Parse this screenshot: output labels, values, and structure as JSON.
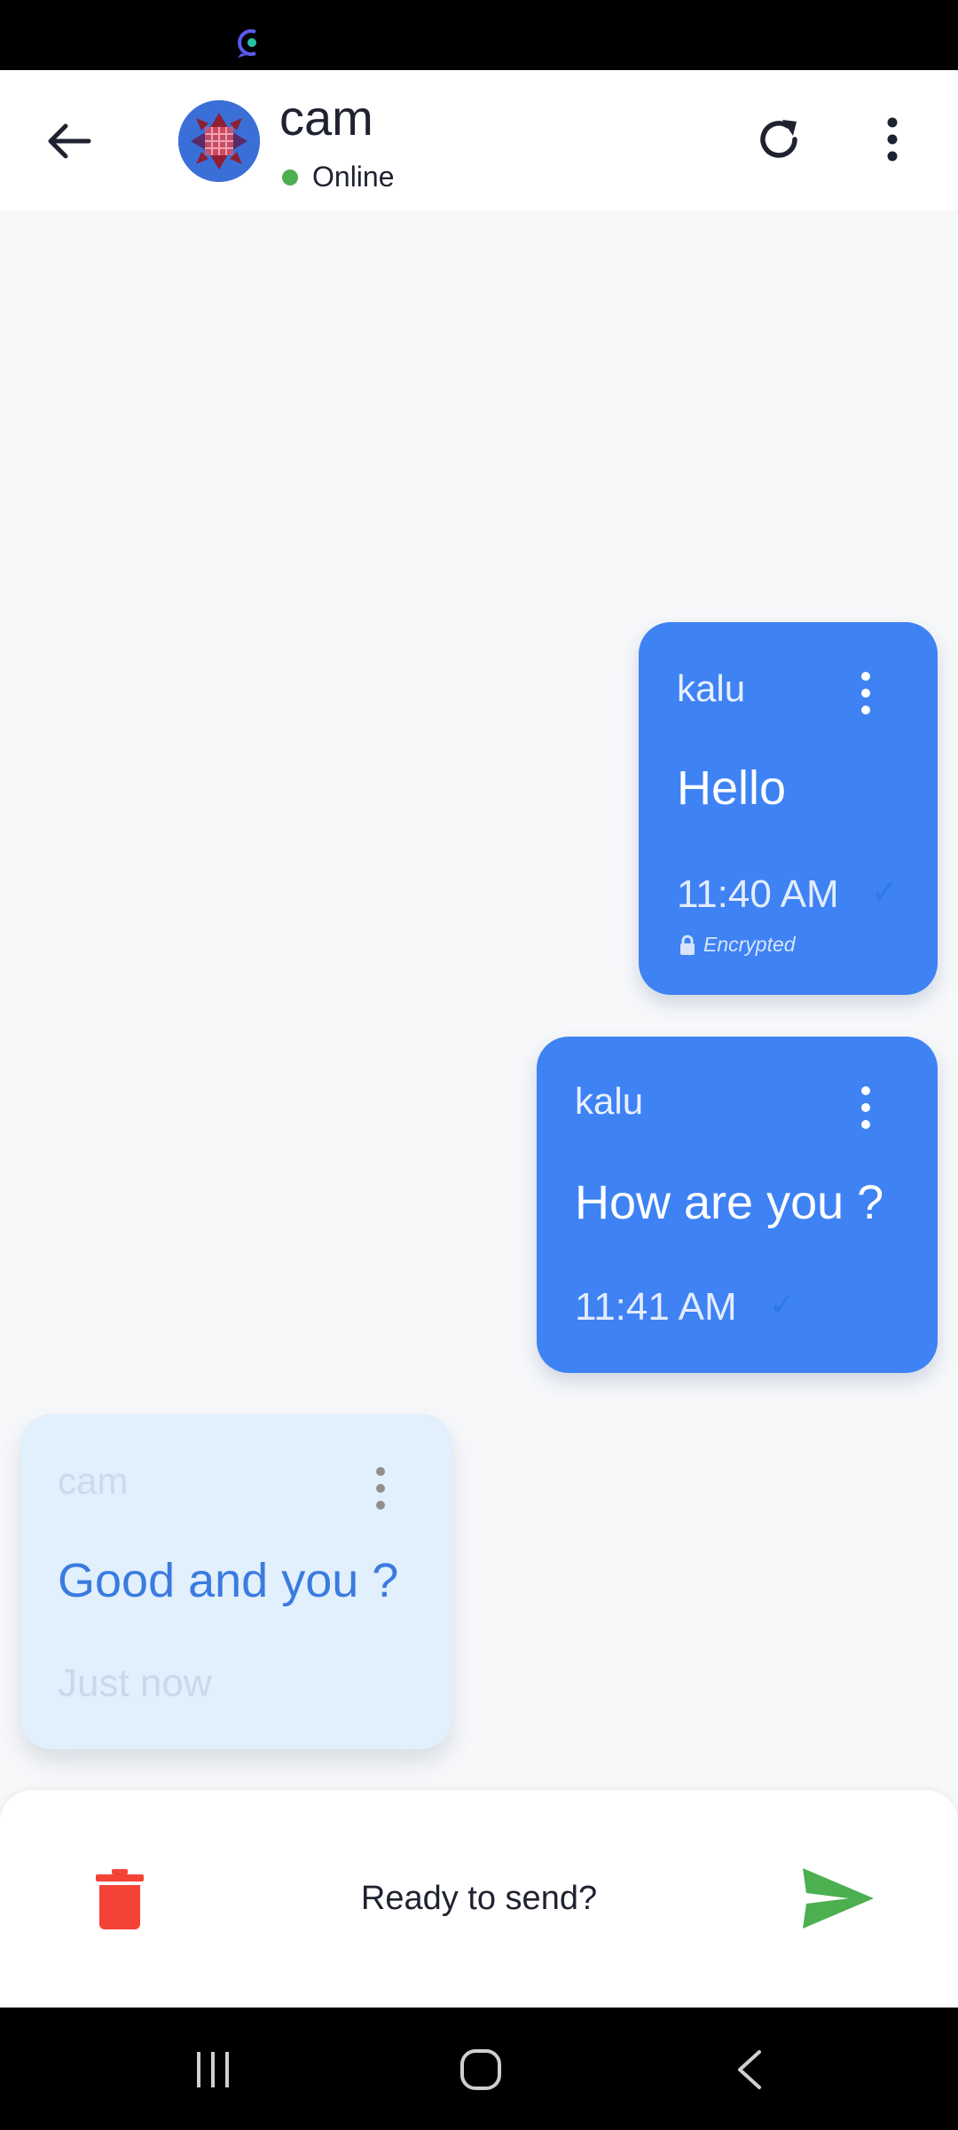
{
  "status_bar": {
    "logo_icon": "chat-app-logo-icon"
  },
  "header": {
    "back_icon": "arrow-left-icon",
    "contact_name": "cam",
    "presence": "Online",
    "presence_color": "#4caf50",
    "refresh_icon": "refresh-icon",
    "menu_icon": "more-vertical-icon"
  },
  "messages": [
    {
      "direction": "outgoing",
      "sender": "kalu",
      "text": "Hello",
      "time": "11:40 AM",
      "status": "✓",
      "encrypted_label": "Encrypted"
    },
    {
      "direction": "outgoing",
      "sender": "kalu",
      "text": "How are you ?",
      "time": "11:41 AM",
      "status": "✓"
    },
    {
      "direction": "incoming",
      "sender": "cam",
      "text": "Good and you ?",
      "time": "Just now"
    }
  ],
  "action_bar": {
    "delete_icon": "trash-icon",
    "prompt": "Ready to send?",
    "send_icon": "send-icon"
  },
  "colors": {
    "outgoing_bubble": "#3e82f4",
    "incoming_bubble": "#e2effc",
    "delete": "#f44336",
    "send": "#4caf50"
  },
  "nav_bar": {
    "recents_icon": "recents-icon",
    "home_icon": "home-icon",
    "back_icon": "nav-back-icon"
  }
}
